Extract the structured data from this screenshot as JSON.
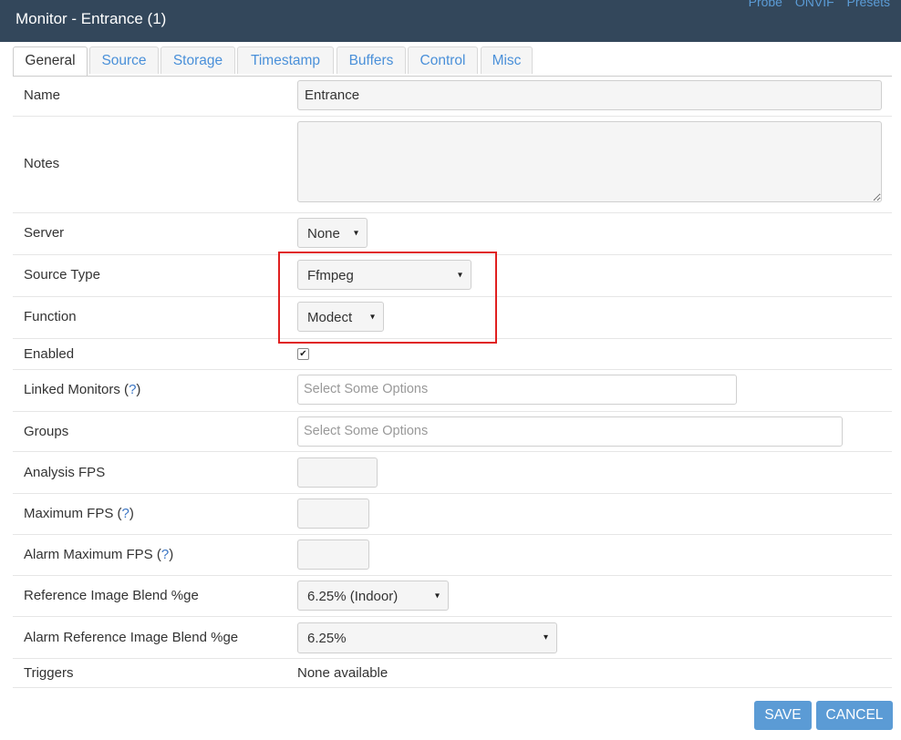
{
  "header": {
    "title": "Monitor - Entrance (1)",
    "links": [
      "Probe",
      "ONVIF",
      "Presets"
    ]
  },
  "tabs": [
    "General",
    "Source",
    "Storage",
    "Timestamp",
    "Buffers",
    "Control",
    "Misc"
  ],
  "form": {
    "name": {
      "label": "Name",
      "value": "Entrance"
    },
    "notes": {
      "label": "Notes",
      "value": ""
    },
    "server": {
      "label": "Server",
      "value": "None"
    },
    "source_type": {
      "label": "Source Type",
      "value": "Ffmpeg"
    },
    "function": {
      "label": "Function",
      "value": "Modect"
    },
    "enabled": {
      "label": "Enabled",
      "checked": true,
      "mark": "✔"
    },
    "linked_monitors": {
      "label": "Linked Monitors",
      "help": "?",
      "placeholder": "Select Some Options"
    },
    "groups": {
      "label": "Groups",
      "placeholder": "Select Some Options"
    },
    "analysis_fps": {
      "label": "Analysis FPS",
      "value": ""
    },
    "maximum_fps": {
      "label": "Maximum FPS",
      "help": "?",
      "value": ""
    },
    "alarm_maximum_fps": {
      "label": "Alarm Maximum FPS",
      "help": "?",
      "value": ""
    },
    "reference_blend": {
      "label": "Reference Image Blend %ge",
      "value": "6.25% (Indoor)"
    },
    "alarm_reference_blend": {
      "label": "Alarm Reference Image Blend %ge",
      "value": "6.25%"
    },
    "triggers": {
      "label": "Triggers",
      "value": "None available"
    }
  },
  "buttons": {
    "save": "SAVE",
    "cancel": "CANCEL"
  },
  "icons": {
    "caret": "▾"
  },
  "colors": {
    "header_bg": "#33475b",
    "accent": "#5b9bd5",
    "highlight": "#e02020"
  }
}
